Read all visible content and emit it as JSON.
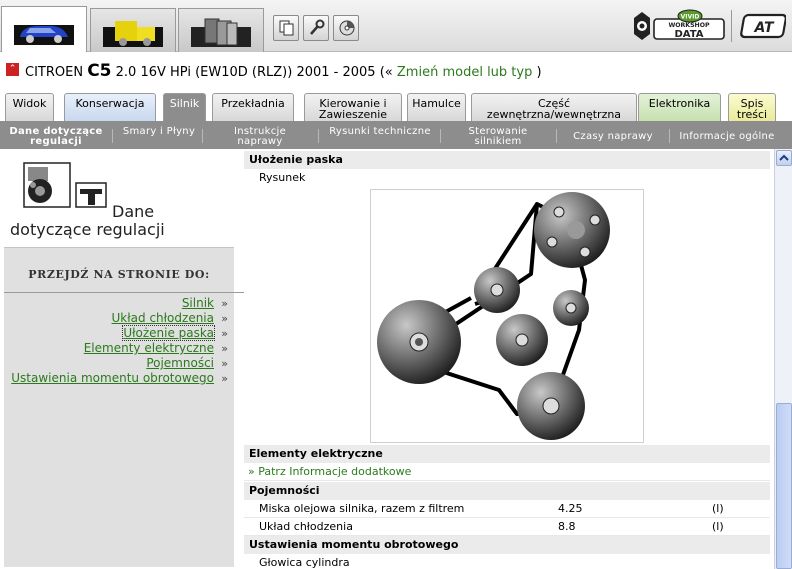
{
  "vehicle_tabs": [
    {
      "icon": "car-icon",
      "active": true
    },
    {
      "icon": "truck-icon",
      "active": false
    },
    {
      "icon": "documents-icon",
      "active": false
    }
  ],
  "toolbar": [
    {
      "icon": "copy-pages-icon"
    },
    {
      "icon": "wrench-key-icon"
    },
    {
      "icon": "disc-icon"
    }
  ],
  "logo": {
    "badge": "VIVID",
    "line1": "WORKSHOP",
    "line2": "DATA",
    "secondary": "AT"
  },
  "model": {
    "make": "CITROEN",
    "model": "C5",
    "spec": "2.0 16V HPi (EW10D (RLZ)) 2001 - 2005",
    "open": "(«",
    "change_link": "Zmień model lub typ",
    "close": ")"
  },
  "category_tabs": [
    {
      "label": "Widok",
      "style": "plain"
    },
    {
      "label": "Konserwacja",
      "style": "blue"
    },
    {
      "label": "Silnik",
      "style": "active"
    },
    {
      "label": "Przekładnia",
      "style": "plain"
    },
    {
      "label": "Kierowanie i Zawieszenie",
      "style": "plain"
    },
    {
      "label": "Hamulce",
      "style": "plain"
    },
    {
      "label": "Część zewnętrzna/wewnętrzna",
      "style": "plain"
    },
    {
      "label": "Elektronika",
      "style": "green"
    },
    {
      "label": "Spis treści",
      "style": "yellow"
    }
  ],
  "sub_nav": [
    {
      "label": "Dane dotyczące regulacji",
      "active": true
    },
    {
      "label": "Smary i Płyny",
      "active": false
    },
    {
      "label": "Instrukcje naprawy",
      "active": false
    },
    {
      "label": "Rysunki techniczne",
      "active": false
    },
    {
      "label": "Sterowanie silnikiem",
      "active": false
    },
    {
      "label": "Czasy naprawy",
      "active": false
    },
    {
      "label": "Informacje ogólne",
      "active": false
    }
  ],
  "left_panel": {
    "title_line1": "Dane",
    "title_line2": "dotyczące regulacji",
    "jump_header": "PRZEJDŹ NA STRONIE DO:",
    "jump_links": [
      {
        "label": "Silnik",
        "selected": false
      },
      {
        "label": "Układ chłodzenia",
        "selected": false
      },
      {
        "label": "Ułożenie paska",
        "selected": true
      },
      {
        "label": "Elementy elektryczne",
        "selected": false
      },
      {
        "label": "Pojemności",
        "selected": false
      },
      {
        "label": "Ustawienia momentu obrotowego",
        "selected": false
      }
    ],
    "arrow": "»"
  },
  "main": {
    "belt_section": {
      "title": "Ułożenie paska",
      "drawing_label": "Rysunek"
    },
    "electrical_section": {
      "title": "Elementy elektryczne",
      "link": "» Patrz Informacje dodatkowe"
    },
    "capacities_section": {
      "title": "Pojemności",
      "rows": [
        {
          "label": "Miska olejowa silnika, razem z filtrem",
          "value": "4.25",
          "unit": "(l)"
        },
        {
          "label": "Układ chłodzenia",
          "value": "8.8",
          "unit": "(l)"
        }
      ]
    },
    "torque_section": {
      "title": "Ustawienia momentu obrotowego",
      "first_row": "Głowica cylindra"
    }
  },
  "colors": {
    "link_green": "#2b7a1c",
    "tab_active_grey": "#8d8d8d",
    "subnav_grey": "#8d8d8d"
  }
}
